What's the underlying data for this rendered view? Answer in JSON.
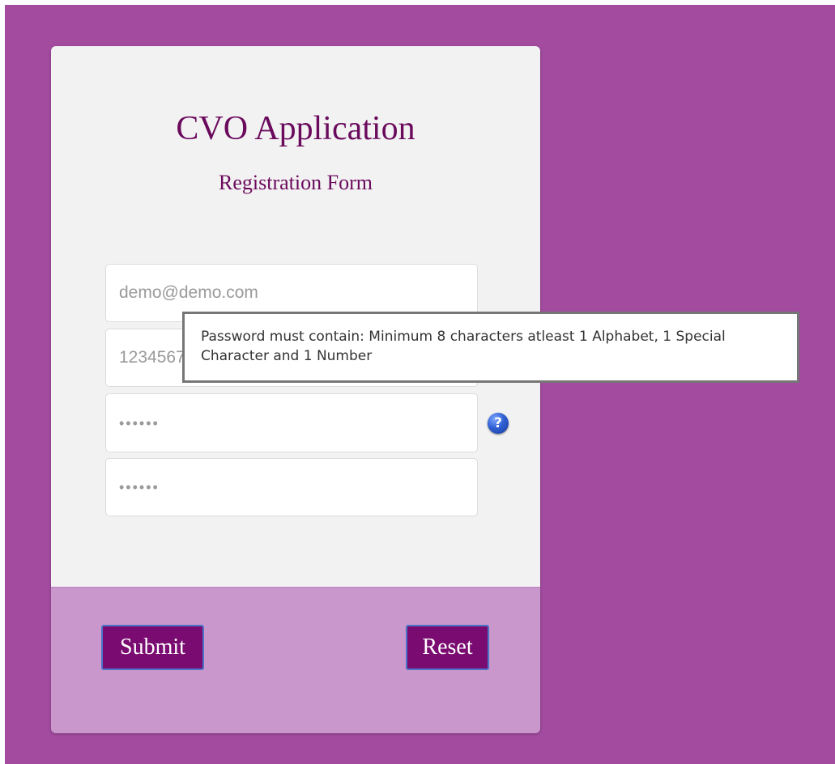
{
  "colors": {
    "page_background": "#a24b9f",
    "card_background": "#f3f2f3",
    "footer_background": "#c997cb",
    "title_color": "#6a0a5c",
    "button_background": "#7a0b70",
    "button_border": "#4b73c8"
  },
  "form": {
    "title": "CVO Application",
    "subtitle": "Registration Form",
    "fields": {
      "email_placeholder": "demo@demo.com",
      "phone_placeholder": "1234567890",
      "password_placeholder": "••••••",
      "confirm_password_placeholder": "••••••"
    },
    "help_icon": "question-mark-icon",
    "help_icon_glyph": "?",
    "tooltip": "Password must contain: Minimum 8 characters atleast 1 Alphabet, 1 Special Character and 1 Number"
  },
  "buttons": {
    "submit_label": "Submit",
    "reset_label": "Reset"
  }
}
